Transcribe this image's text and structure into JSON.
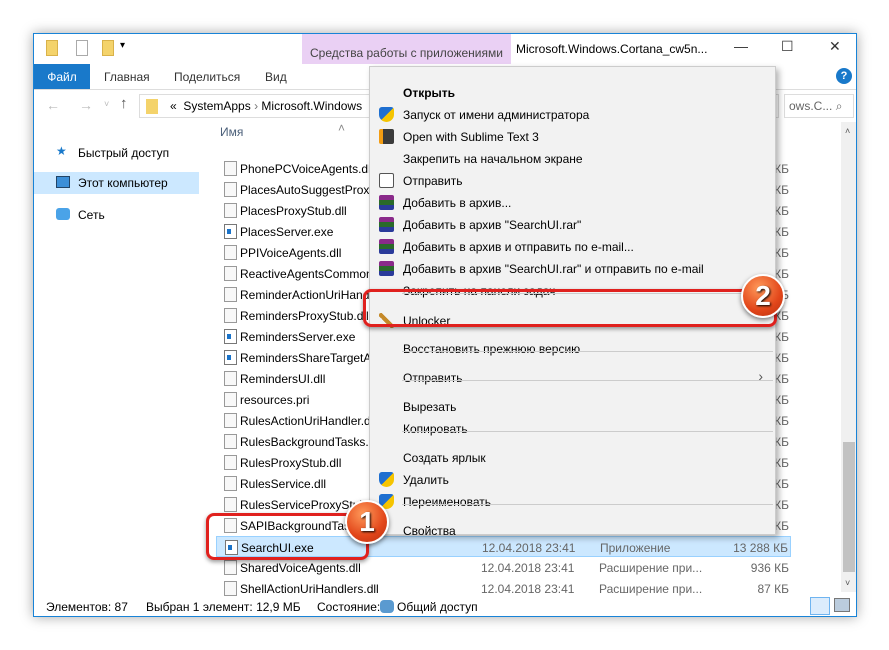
{
  "window": {
    "title": "Microsoft.Windows.Cortana_cw5n...",
    "context_tab": "Средства работы с приложениями",
    "minimize": "—",
    "maximize": "☐",
    "close": "✕"
  },
  "ribbon": {
    "tabs": [
      "Файл",
      "Главная",
      "Поделиться",
      "Вид"
    ]
  },
  "address": {
    "path_prefix": "«",
    "crumbs": [
      "SystemApps",
      "Microsoft.Windows"
    ],
    "search_tail": "ows.C..."
  },
  "nav": {
    "items": [
      {
        "label": "Быстрый доступ",
        "icon": "star-icon"
      },
      {
        "label": "Этот компьютер",
        "icon": "computer-icon",
        "selected": true
      },
      {
        "label": "Сеть",
        "icon": "network-icon"
      }
    ]
  },
  "list": {
    "header": "Имя",
    "rows": [
      {
        "name": "PhonePCVoiceAgents.dll",
        "type": "dll",
        "size": "КБ"
      },
      {
        "name": "PlacesAutoSuggestProxy",
        "type": "dll",
        "size": "КБ"
      },
      {
        "name": "PlacesProxyStub.dll",
        "type": "dll",
        "size": "КБ"
      },
      {
        "name": "PlacesServer.exe",
        "type": "exe",
        "size": "КБ"
      },
      {
        "name": "PPIVoiceAgents.dll",
        "type": "dll",
        "size": "КБ"
      },
      {
        "name": "ReactiveAgentsCommon",
        "type": "dll",
        "size": "КБ"
      },
      {
        "name": "ReminderActionUriHand",
        "type": "dll",
        "size": "КБ"
      },
      {
        "name": "RemindersProxyStub.dll",
        "type": "dll",
        "size": "КБ"
      },
      {
        "name": "RemindersServer.exe",
        "type": "exe",
        "size": "КБ"
      },
      {
        "name": "RemindersShareTargetAp",
        "type": "exe",
        "size": "КБ"
      },
      {
        "name": "RemindersUI.dll",
        "type": "dll",
        "size": "КБ"
      },
      {
        "name": "resources.pri",
        "type": "dll",
        "size": "КБ"
      },
      {
        "name": "RulesActionUriHandler.d",
        "type": "dll",
        "size": "КБ"
      },
      {
        "name": "RulesBackgroundTasks.d",
        "type": "dll",
        "size": "КБ"
      },
      {
        "name": "RulesProxyStub.dll",
        "type": "dll",
        "size": "КБ"
      },
      {
        "name": "RulesService.dll",
        "type": "dll",
        "size": "КБ"
      },
      {
        "name": "RulesServiceProxyStub.dll",
        "type": "dll",
        "size": "КБ"
      },
      {
        "name": "SAPIBackgroundTask",
        "type": "dll",
        "size": "КБ"
      },
      {
        "name": "SearchUI.exe",
        "type": "exe",
        "date": "12.04.2018 23:41",
        "kind": "Приложение",
        "size": "13 288 КБ",
        "selected": true
      },
      {
        "name": "SharedVoiceAgents.dll",
        "type": "dll",
        "date": "12.04.2018 23:41",
        "kind": "Расширение при...",
        "size": "936 КБ"
      },
      {
        "name": "ShellActionUriHandlers.dll",
        "type": "dll",
        "date": "12.04.2018 23:41",
        "kind": "Расширение при...",
        "size": "87 КБ"
      }
    ]
  },
  "status": {
    "count": "Элементов: 87",
    "selected": "Выбран 1 элемент: 12,9 МБ",
    "state": "Состояние:",
    "share": "Общий доступ"
  },
  "menu": {
    "items": [
      {
        "label": "Открыть",
        "bold": true
      },
      {
        "label": "Запуск от имени администратора",
        "icon": "shield-icon"
      },
      {
        "label": "Open with Sublime Text 3",
        "icon": "sublime-icon"
      },
      {
        "label": "Закрепить на начальном экране"
      },
      {
        "label": "Отправить",
        "icon": "share-icon"
      },
      {
        "label": "Добавить в архив...",
        "icon": "winrar-icon"
      },
      {
        "label": "Добавить в архив \"SearchUI.rar\"",
        "icon": "winrar-icon"
      },
      {
        "label": "Добавить в архив и отправить по e-mail...",
        "icon": "winrar-icon"
      },
      {
        "label": "Добавить в архив \"SearchUI.rar\" и отправить по e-mail",
        "icon": "winrar-icon"
      },
      {
        "label": "Закрепить на панели задач"
      },
      {
        "label": "Unlocker",
        "icon": "wand-icon"
      },
      {
        "label": "Восстановить прежнюю версию"
      },
      {
        "label": "Отправить",
        "submenu": true
      },
      {
        "label": "Вырезать"
      },
      {
        "label": "Копировать"
      },
      {
        "label": "Создать ярлык"
      },
      {
        "label": "Удалить",
        "icon": "shield-icon"
      },
      {
        "label": "Переименовать",
        "icon": "shield-icon"
      },
      {
        "label": "Свойства"
      }
    ]
  },
  "annotations": {
    "one": "1",
    "two": "2"
  },
  "colors": {
    "accent": "#1979ca",
    "highlight": "#e0211e",
    "context_tab": "#ead0f4",
    "selection": "#cce8ff"
  }
}
